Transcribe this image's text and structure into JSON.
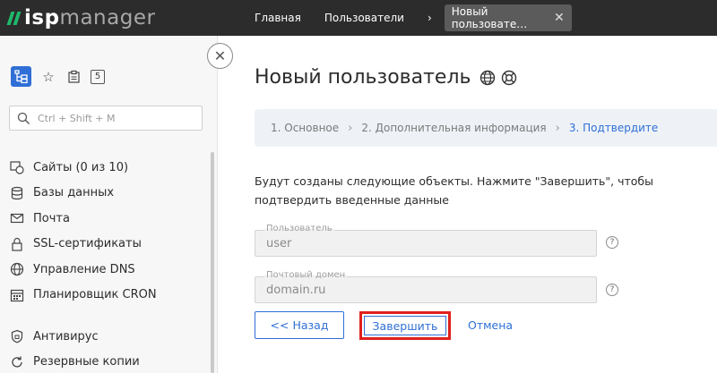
{
  "app": {
    "logo_prefix": "isp",
    "logo_suffix": "manager"
  },
  "breadcrumbs": {
    "home": "Главная",
    "users": "Пользователи",
    "active_tab": "Новый пользовате…"
  },
  "sidebar": {
    "badge_count": "5",
    "search_placeholder": "Ctrl + Shift + M",
    "items": [
      {
        "label": "Сайты (0 из 10)",
        "icon": "sites-icon"
      },
      {
        "label": "Базы данных",
        "icon": "database-icon"
      },
      {
        "label": "Почта",
        "icon": "mail-icon"
      },
      {
        "label": "SSL-сертификаты",
        "icon": "lock-icon"
      },
      {
        "label": "Управление DNS",
        "icon": "globe-icon"
      },
      {
        "label": "Планировщик CRON",
        "icon": "calendar-icon"
      },
      {
        "label": "Антивирус",
        "icon": "shield-icon"
      },
      {
        "label": "Резервные копии",
        "icon": "backup-icon"
      }
    ]
  },
  "main": {
    "title": "Новый пользователь",
    "steps": [
      {
        "label": "1. Основное",
        "active": false
      },
      {
        "label": "2. Дополнительная информация",
        "active": false
      },
      {
        "label": "3. Подтвердите",
        "active": true
      }
    ],
    "description": "Будут созданы следующие объекты. Нажмите \"Завершить\", чтобы подтвердить введенные данные",
    "fields": [
      {
        "label": "Пользователь",
        "value": "user"
      },
      {
        "label": "Почтовый домен",
        "value": "domain.ru"
      }
    ],
    "buttons": {
      "back": "<< Назад",
      "finish": "Завершить",
      "cancel": "Отмена"
    }
  },
  "colors": {
    "topbar": "#2c2c2c",
    "accent": "#2f6fd6",
    "logo_green": "#1fb86b",
    "highlight_red": "#e0201d"
  }
}
